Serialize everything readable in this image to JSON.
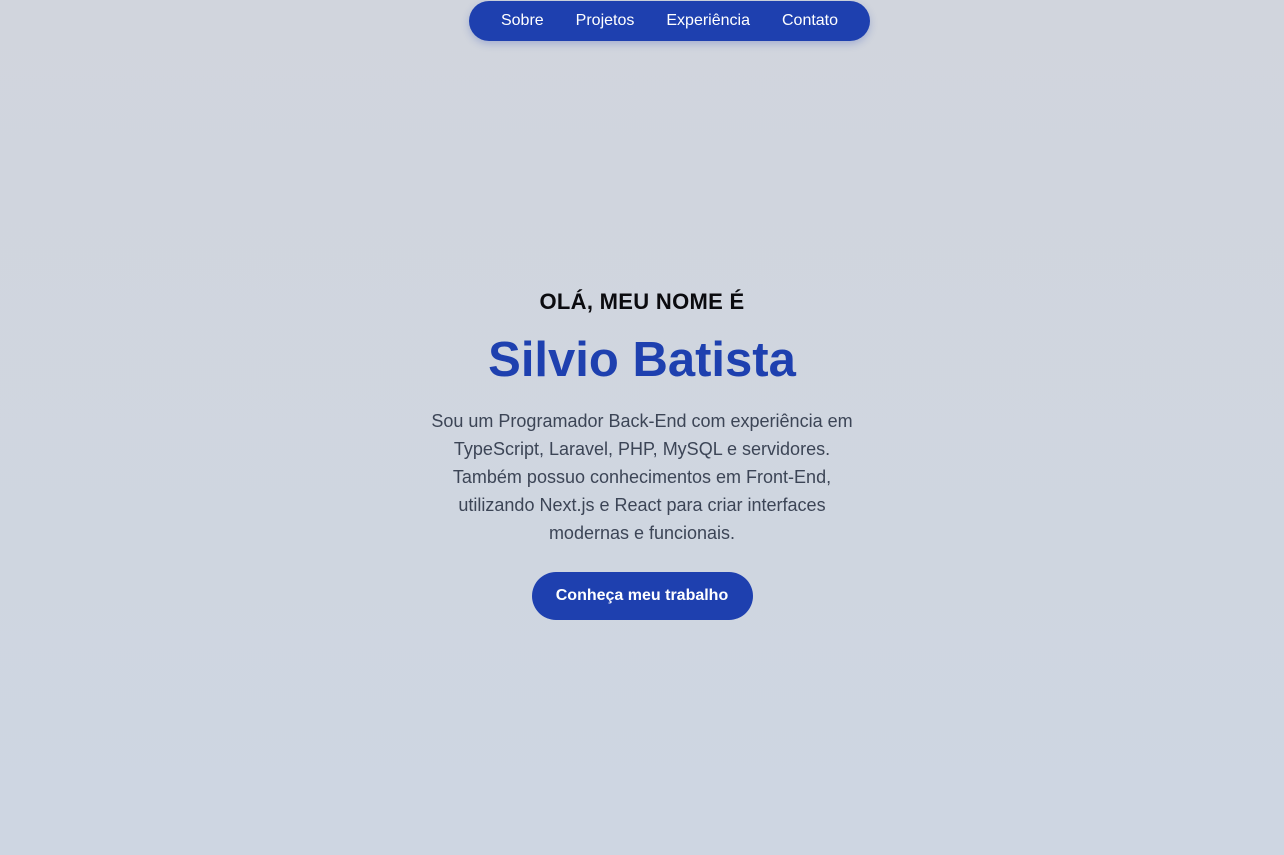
{
  "nav": {
    "items": [
      {
        "label": "Sobre"
      },
      {
        "label": "Projetos"
      },
      {
        "label": "Experiência"
      },
      {
        "label": "Contato"
      }
    ]
  },
  "hero": {
    "greeting": "OLÁ, MEU NOME É",
    "name": "Silvio Batista",
    "bio": "Sou um Programador Back-End com experiência em TypeScript, Laravel, PHP, MySQL e servidores. Também possuo conhecimentos em Front-End, utilizando Next.js e React para criar interfaces modernas e funcionais.",
    "cta_label": "Conheça meu trabalho"
  },
  "colors": {
    "primary": "#1e40af",
    "background": "#d1d5dd",
    "text_muted": "#3c4556",
    "text_dark": "#0b0b0f"
  }
}
